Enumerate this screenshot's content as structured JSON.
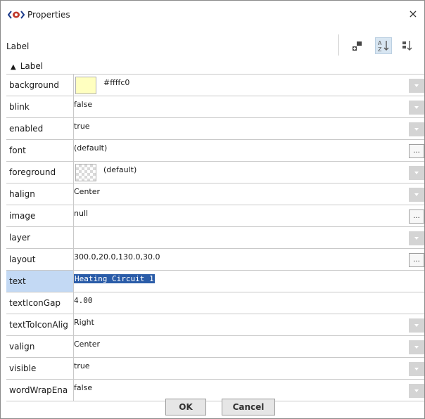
{
  "dialog": {
    "title": "Properties",
    "close_label": "×"
  },
  "toolbar": {
    "label": "Label",
    "buttons": [
      "add-property-icon",
      "sort-alphabetical-icon",
      "sort-category-icon"
    ]
  },
  "group": {
    "label": "Label",
    "caret": "▲"
  },
  "properties": [
    {
      "name": "background",
      "value": "#ffffc0",
      "control": "dropdown",
      "swatch": "#ffffc0"
    },
    {
      "name": "blink",
      "value": "false",
      "control": "dropdown"
    },
    {
      "name": "enabled",
      "value": "true",
      "control": "dropdown"
    },
    {
      "name": "font",
      "value": "(default)",
      "control": "ellipsis"
    },
    {
      "name": "foreground",
      "value": "(default)",
      "control": "dropdown",
      "swatch": "checker"
    },
    {
      "name": "halign",
      "value": "Center",
      "control": "dropdown"
    },
    {
      "name": "image",
      "value": "null",
      "control": "ellipsis"
    },
    {
      "name": "layer",
      "value": "",
      "control": "dropdown"
    },
    {
      "name": "layout",
      "value": "300.0,20.0,130.0,30.0",
      "control": "ellipsis"
    },
    {
      "name": "text",
      "value": "Heating Circuit 1",
      "control": "none",
      "selected": true
    },
    {
      "name": "textIconGap",
      "value": "4.00",
      "control": "none"
    },
    {
      "name": "textToIconAlig",
      "value": "Right",
      "control": "dropdown"
    },
    {
      "name": "valign",
      "value": "Center",
      "control": "dropdown"
    },
    {
      "name": "visible",
      "value": "true",
      "control": "dropdown"
    },
    {
      "name": "wordWrapEna",
      "value": "false",
      "control": "dropdown"
    }
  ],
  "buttons": {
    "ok": "OK",
    "cancel": "Cancel",
    "ellipsis": "..."
  },
  "colors": {
    "selected_row": "#c3d9f4",
    "text_selection": "#2a5ca8",
    "dropdown_button": "#d4d4d4",
    "background_swatch": "#ffffc0"
  }
}
